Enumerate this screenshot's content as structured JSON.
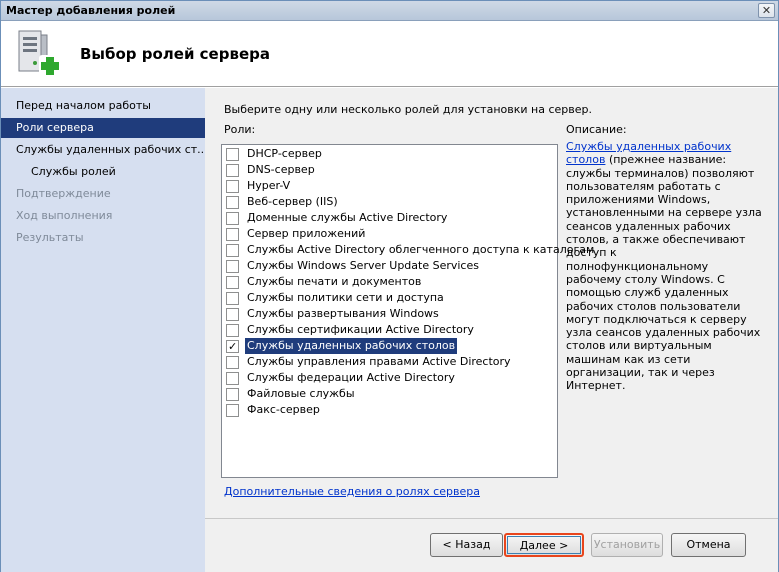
{
  "window": {
    "title": "Мастер добавления ролей",
    "close_label": "✕"
  },
  "header": {
    "title": "Выбор ролей сервера",
    "icon": "server-add-icon"
  },
  "sidebar": {
    "items": [
      {
        "label": "Перед началом работы",
        "state": "normal"
      },
      {
        "label": "Роли сервера",
        "state": "active"
      },
      {
        "label": "Службы удаленных рабочих ст...",
        "state": "normal"
      },
      {
        "label": "Службы ролей",
        "state": "sub"
      },
      {
        "label": "Подтверждение",
        "state": "disabled"
      },
      {
        "label": "Ход выполнения",
        "state": "disabled"
      },
      {
        "label": "Результаты",
        "state": "disabled"
      }
    ]
  },
  "main": {
    "instruction": "Выберите одну или несколько ролей для установки на сервер.",
    "roles_label": "Роли:",
    "roles": [
      {
        "label": "DHCP-сервер",
        "checked": false
      },
      {
        "label": "DNS-сервер",
        "checked": false
      },
      {
        "label": "Hyper-V",
        "checked": false
      },
      {
        "label": "Веб-сервер (IIS)",
        "checked": false
      },
      {
        "label": "Доменные службы Active Directory",
        "checked": false
      },
      {
        "label": "Сервер приложений",
        "checked": false
      },
      {
        "label": "Службы Active Directory облегченного доступа к каталогам",
        "checked": false
      },
      {
        "label": "Службы Windows Server Update Services",
        "checked": false
      },
      {
        "label": "Службы печати и документов",
        "checked": false
      },
      {
        "label": "Службы политики сети и доступа",
        "checked": false
      },
      {
        "label": "Службы развертывания Windows",
        "checked": false
      },
      {
        "label": "Службы сертификации Active Directory",
        "checked": false
      },
      {
        "label": "Службы удаленных рабочих столов",
        "checked": true,
        "selected": true
      },
      {
        "label": "Службы управления правами Active Directory",
        "checked": false
      },
      {
        "label": "Службы федерации Active Directory",
        "checked": false
      },
      {
        "label": "Файловые службы",
        "checked": false
      },
      {
        "label": "Факс-сервер",
        "checked": false
      }
    ],
    "description_label": "Описание:",
    "description_link": "Службы удаленных рабочих столов",
    "description_text": "(прежнее название: службы терминалов) позволяют пользователям работать с приложениями Windows, установленными на сервере узла сеансов удаленных рабочих столов, а также обеспечивают доступ к полнофункциональному рабочему столу Windows. С помощью служб удаленных рабочих столов пользователи могут подключаться к серверу узла сеансов удаленных рабочих столов или виртуальным машинам как из сети организации, так и через Интернет.",
    "more_info_link": "Дополнительные сведения о ролях сервера"
  },
  "footer": {
    "back_label": "< Назад",
    "next_label": "Далее >",
    "install_label": "Установить",
    "cancel_label": "Отмена"
  },
  "colors": {
    "accent": "#1f3c7c",
    "sidebar_bg": "#d6dff0",
    "highlight_border": "#e8451c",
    "link": "#0033cc"
  }
}
